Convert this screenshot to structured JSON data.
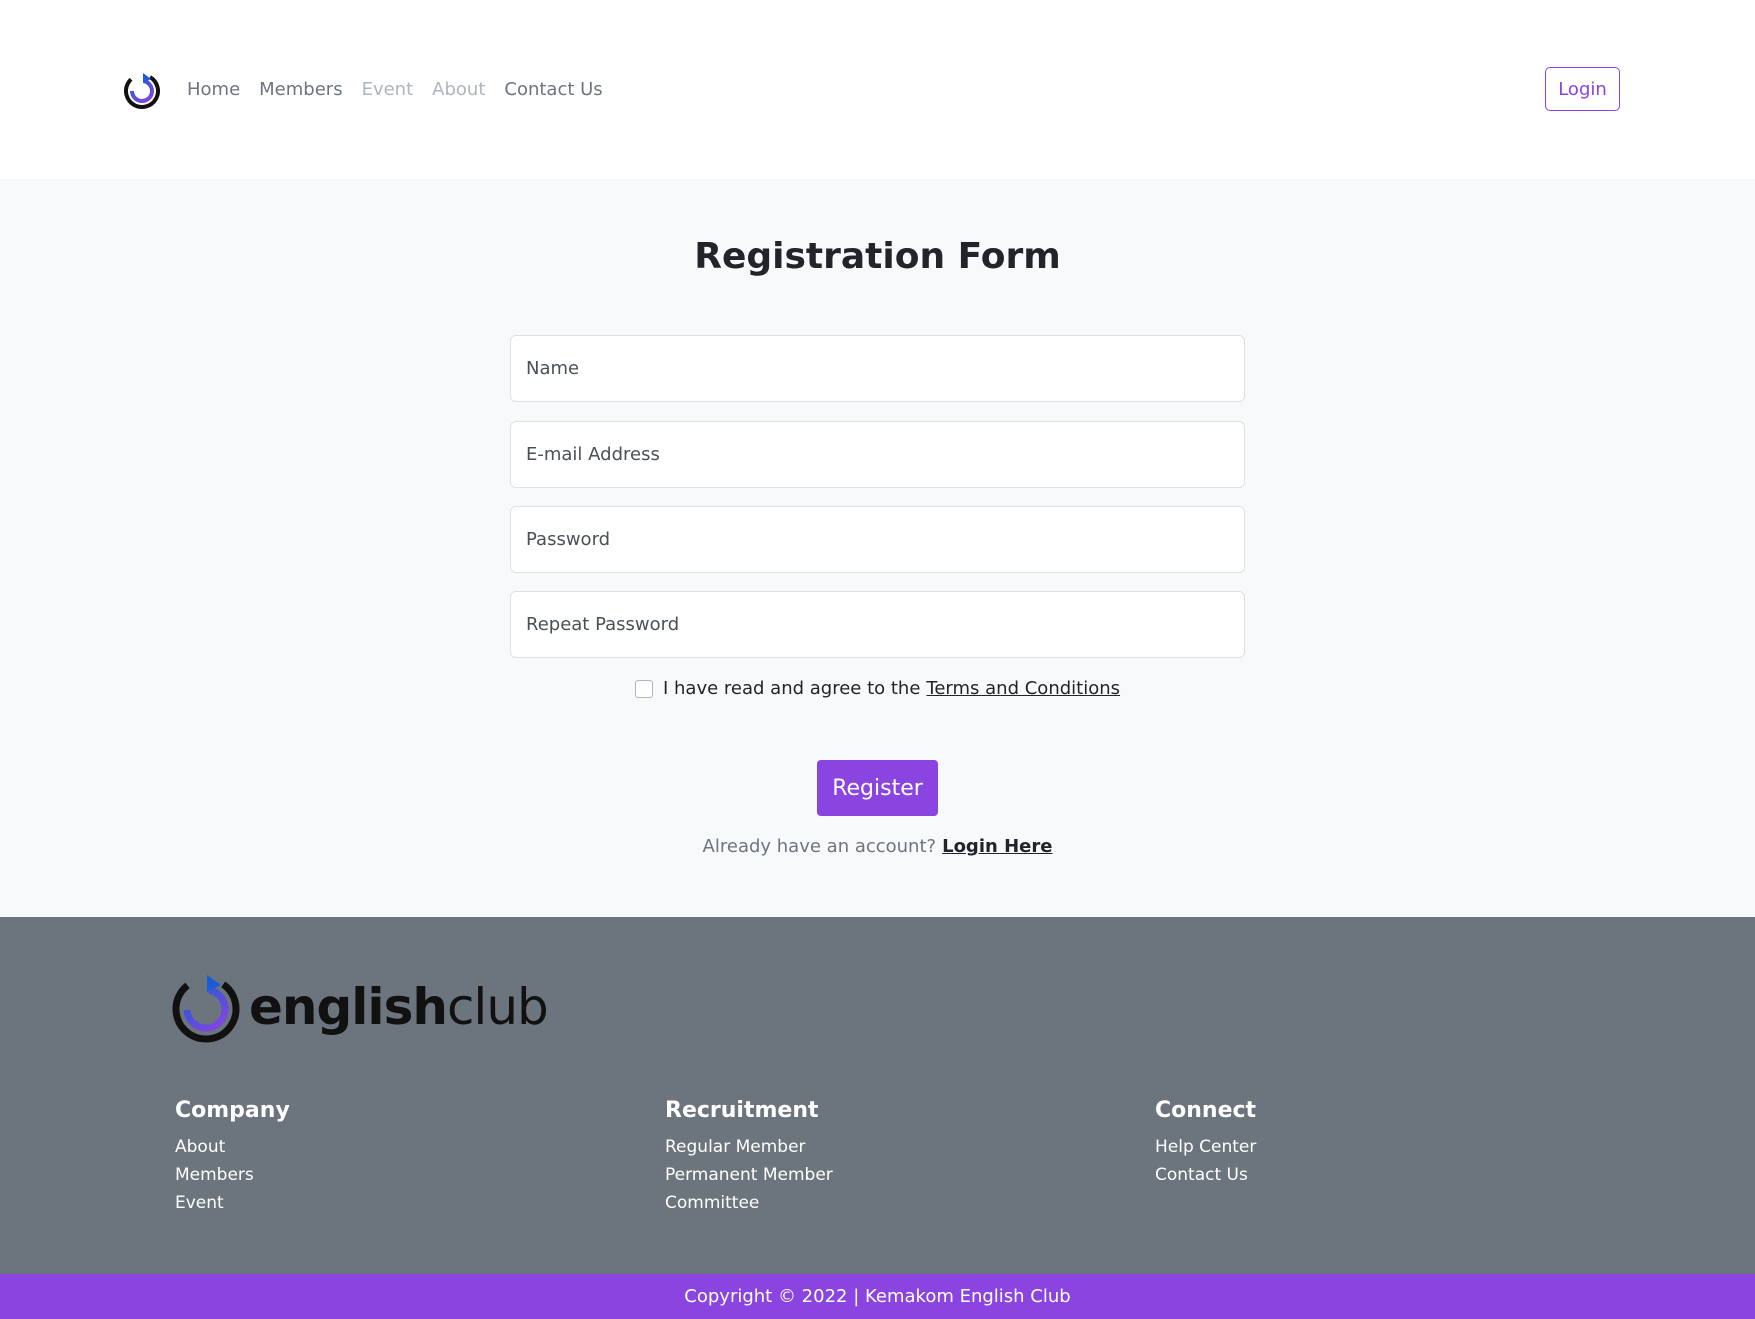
{
  "nav": {
    "links": [
      {
        "label": "Home",
        "muted": false
      },
      {
        "label": "Members",
        "muted": false
      },
      {
        "label": "Event",
        "muted": true
      },
      {
        "label": "About",
        "muted": true
      },
      {
        "label": "Contact Us",
        "muted": false
      }
    ],
    "login_label": "Login"
  },
  "form": {
    "title": "Registration Form",
    "fields": {
      "name_placeholder": "Name",
      "email_placeholder": "E-mail Address",
      "password_placeholder": "Password",
      "repeat_password_placeholder": "Repeat Password"
    },
    "terms_text": "I have read and agree to the",
    "terms_link": "Terms and Conditions",
    "register_label": "Register",
    "login_prompt": "Already have an account?",
    "login_link": "Login Here"
  },
  "footer": {
    "brand": {
      "bold": "english",
      "light": "club"
    },
    "columns": [
      {
        "title": "Company",
        "items": [
          "About",
          "Members",
          "Event"
        ]
      },
      {
        "title": "Recruitment",
        "items": [
          "Regular Member",
          "Permanent Member",
          "Committee"
        ]
      },
      {
        "title": "Connect",
        "items": [
          "Help Center",
          "Contact Us"
        ]
      }
    ],
    "copyright": "Copyright © 2022 | Kemakom English Club"
  },
  "colors": {
    "accent": "#8a44e0",
    "footer_bg": "#6c757d",
    "main_bg": "#f8f9fa"
  },
  "icons": {
    "logo": "refresh-arrow-logo-icon"
  }
}
